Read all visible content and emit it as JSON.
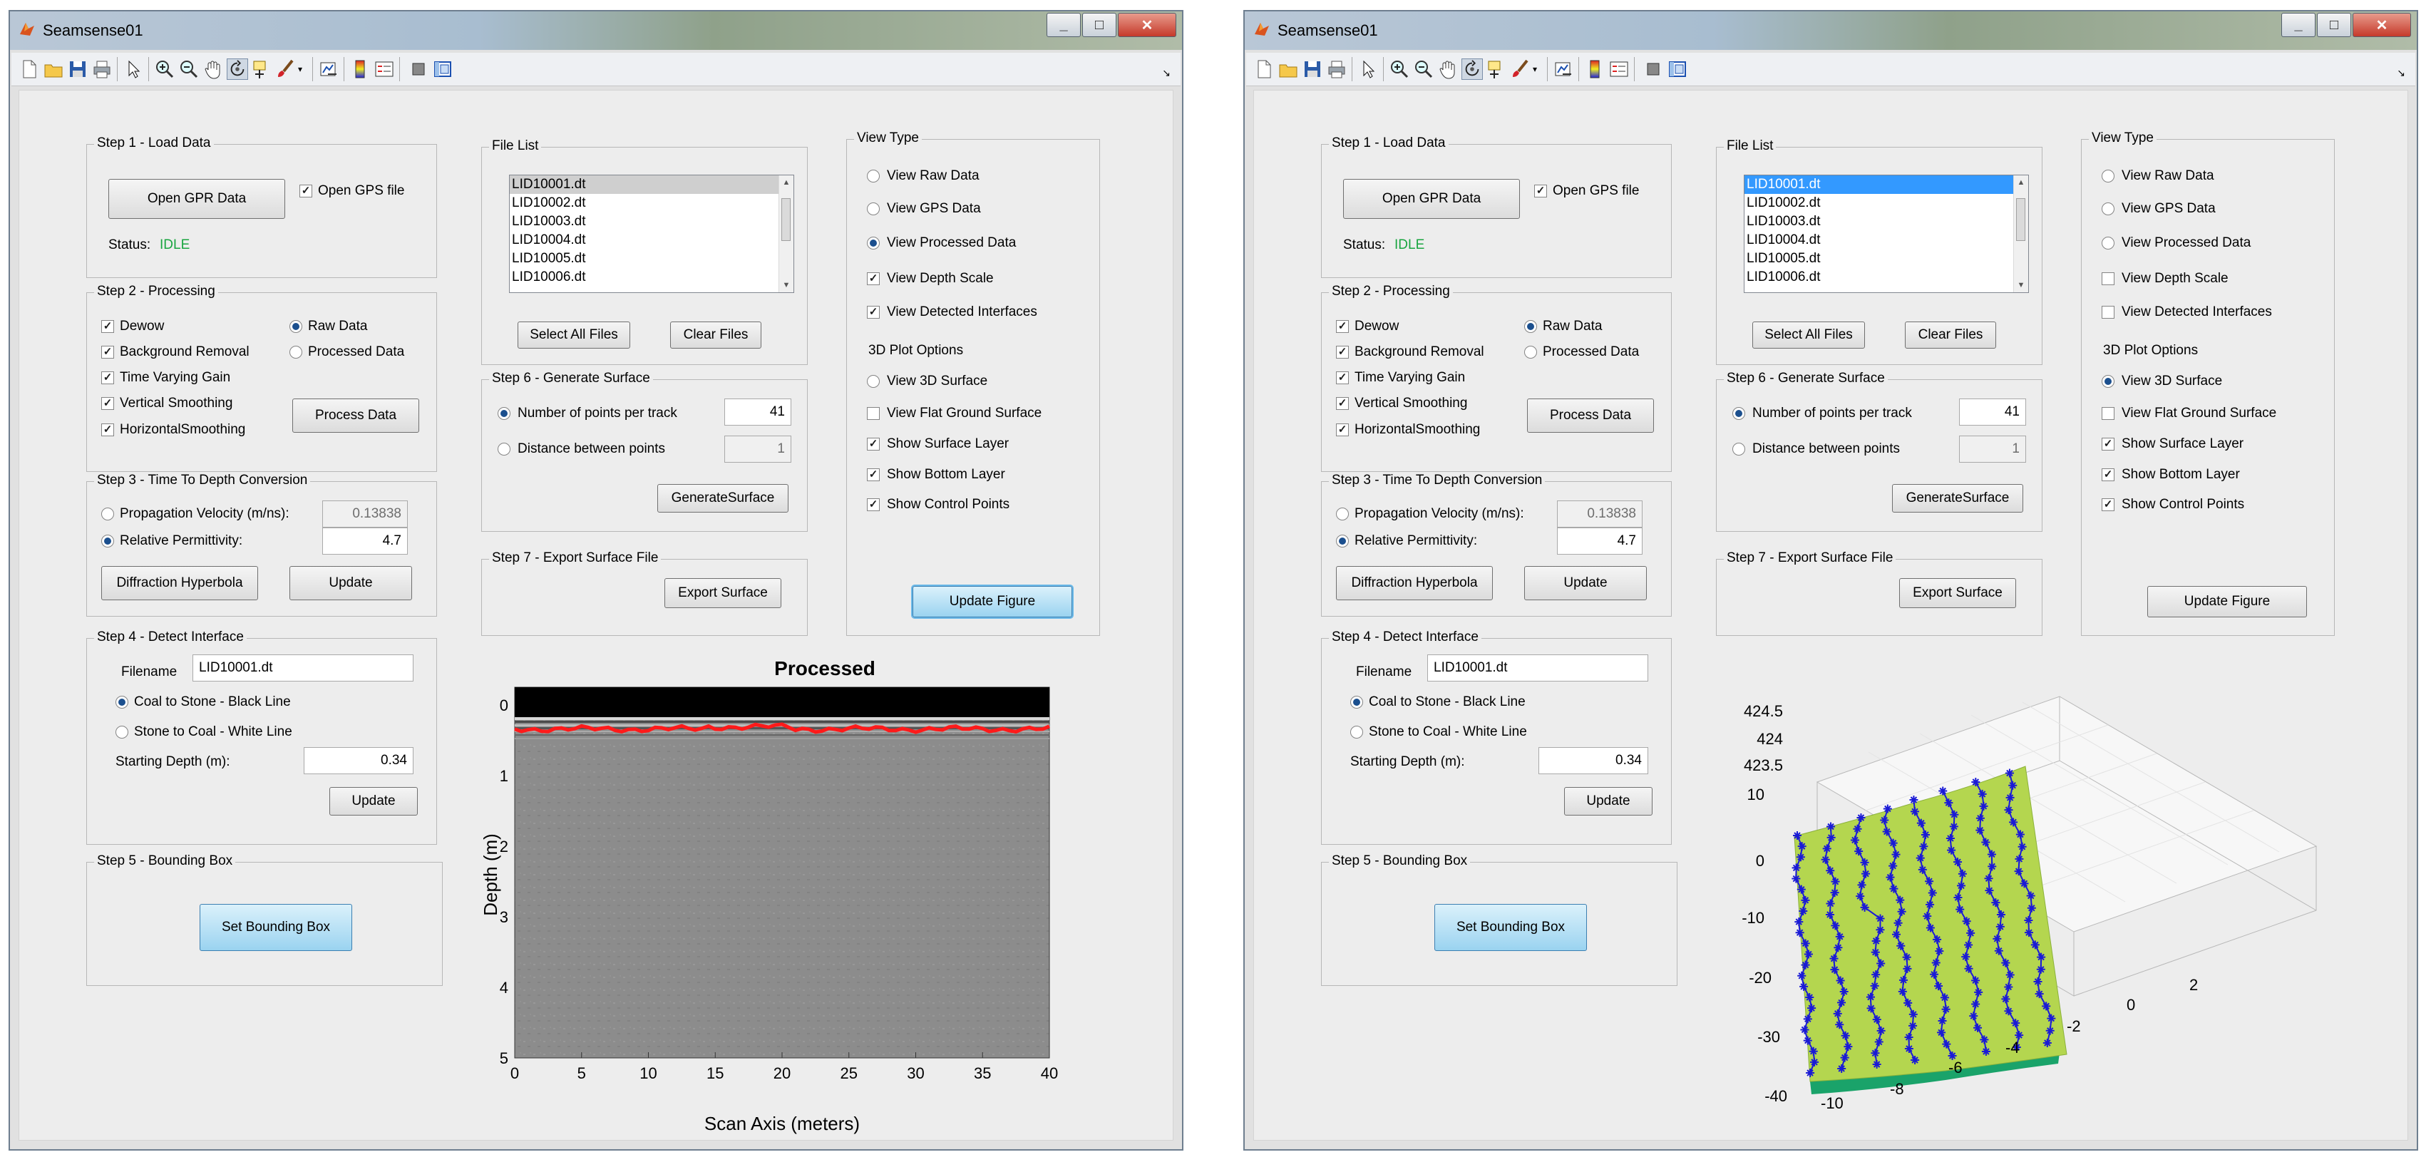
{
  "app": {
    "title": "Seamsense01",
    "window_buttons": [
      "_",
      "□",
      "✕"
    ]
  },
  "toolbar": {
    "icons": [
      "new-file-icon",
      "open-folder-icon",
      "save-icon",
      "print-icon",
      "pointer-icon",
      "zoom-in-icon",
      "zoom-out-icon",
      "pan-hand-icon",
      "rotate-3d-icon",
      "data-cursor-icon",
      "brush-icon",
      "brush-dropdown-icon",
      "link-plot-icon",
      "colorbar-icon",
      "legend-icon",
      "hide-plot-tools-icon",
      "show-plot-tools-icon"
    ],
    "corner": "↘"
  },
  "step1": {
    "title": "Step 1 - Load Data",
    "open_btn": "Open GPR Data",
    "gps_label": "Open GPS file",
    "status_label": "Status:",
    "status_value": "IDLE",
    "status_color": "#19a540"
  },
  "step2": {
    "title": "Step 2 - Processing",
    "checks": [
      "Dewow",
      "Background Removal",
      "Time Varying Gain",
      "Vertical Smoothing",
      "HorizontalSmoothing"
    ],
    "raw_label": "Raw Data",
    "proc_label": "Processed Data",
    "process_btn": "Process Data"
  },
  "step3": {
    "title": "Step 3 - Time To Depth Conversion",
    "prop_label": "Propagation Velocity (m/ns):",
    "prop_value": "0.13838",
    "perm_label": "Relative Permittivity:",
    "perm_value": "4.7",
    "diffraction_btn": "Diffraction Hyperbola",
    "update_btn": "Update"
  },
  "step4": {
    "title": "Step 4 - Detect Interface",
    "filename_label": "Filename",
    "filename_value": "LID10001.dt",
    "coal_label": "Coal to Stone - Black Line",
    "stone_label": "Stone to Coal - White Line",
    "depth_label": "Starting Depth (m):",
    "depth_value": "0.34",
    "update_btn": "Update"
  },
  "step5": {
    "title": "Step 5 - Bounding Box",
    "btn": "Set Bounding Box"
  },
  "filelist": {
    "title": "File List",
    "files": [
      "LID10001.dt",
      "LID10002.dt",
      "LID10003.dt",
      "LID10004.dt",
      "LID10005.dt",
      "LID10006.dt"
    ],
    "select_all_btn": "Select All Files",
    "clear_btn": "Clear Files"
  },
  "step6": {
    "title": "Step 6 - Generate Surface",
    "npoints_label": "Number of points per track",
    "npoints_value": "41",
    "distance_label": "Distance between points",
    "distance_value": "1",
    "generate_btn": "GenerateSurface"
  },
  "step7": {
    "title": "Step 7 - Export Surface File",
    "export_btn": "Export Surface"
  },
  "viewtype": {
    "title": "View Type",
    "raw": "View Raw Data",
    "gps": "View GPS Data",
    "processed": "View Processed Data",
    "depth": "View Depth Scale",
    "interfaces": "View Detected Interfaces",
    "plot3d_title": "3D Plot Options",
    "surface3d": "View 3D Surface",
    "flat": "View Flat Ground Surface",
    "surface_layer": "Show Surface Layer",
    "bottom_layer": "Show Bottom Layer",
    "control_points": "Show Control Points",
    "update_btn": "Update Figure"
  },
  "plot2d": {
    "title": "Processed",
    "xlabel": "Scan Axis (meters)",
    "ylabel": "Depth (m)",
    "xticks": [
      "0",
      "5",
      "10",
      "15",
      "20",
      "25",
      "30",
      "35",
      "40"
    ],
    "yticks": [
      "0",
      "1",
      "2",
      "3",
      "4",
      "5"
    ],
    "colors": {
      "interface": "#ff1a1a"
    }
  },
  "plot3d": {
    "z_ticks": [
      "424.5",
      "424",
      "423.5"
    ],
    "y_ticks": [
      "10",
      "0",
      "-10",
      "-20",
      "-30",
      "-40"
    ],
    "x_ticks": [
      "-10",
      "-8",
      "-6",
      "-4",
      "-2",
      "0",
      "2"
    ],
    "colors": {
      "surface_top": "#c8e05a",
      "surface_bottom": "#74c14a",
      "bottom_layer": "#1aa36a",
      "points": "#1a1ad6"
    }
  },
  "chart_data": [
    {
      "type": "heatmap",
      "title": "Processed",
      "xlabel": "Scan Axis (meters)",
      "ylabel": "Depth (m)",
      "xlim": [
        0,
        40
      ],
      "ylim": [
        5,
        0
      ],
      "interface_depth_m": 0.34
    },
    {
      "type": "scatter",
      "title": "",
      "subtype": "3d-surface",
      "zlim": [
        423.5,
        424.5
      ],
      "xlim": [
        -10,
        2
      ],
      "ylim": [
        -40,
        10
      ],
      "tracks": 8
    }
  ]
}
